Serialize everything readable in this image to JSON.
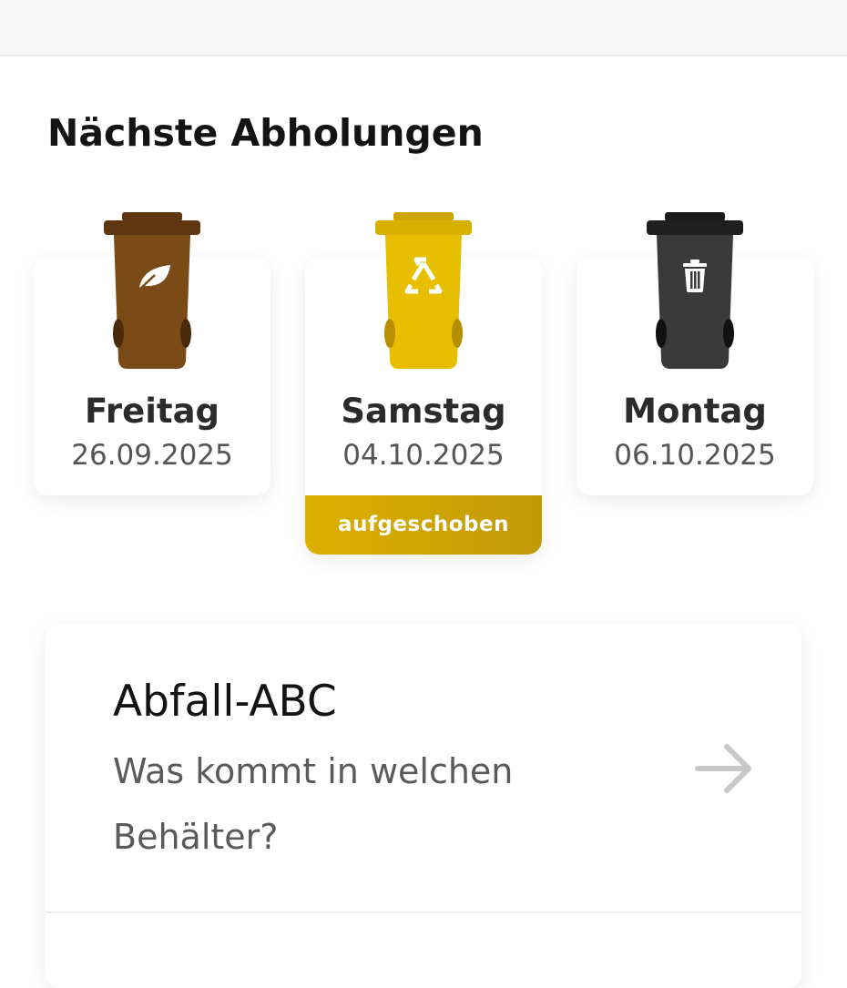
{
  "section_title": "Nächste Abholungen",
  "pickups": [
    {
      "weekday": "Freitag",
      "date": "26.09.2025",
      "bin_type": "Bio",
      "bin_color": "#7a4a17",
      "icon": "leaf-icon",
      "status": ""
    },
    {
      "weekday": "Samstag",
      "date": "04.10.2025",
      "bin_type": "Gelber Sack",
      "bin_color": "#e7bf00",
      "icon": "recycle-icon",
      "status": "aufgeschoben"
    },
    {
      "weekday": "Montag",
      "date": "06.10.2025",
      "bin_type": "Restmüll",
      "bin_color": "#3a3a3a",
      "icon": "trash-icon",
      "status": ""
    }
  ],
  "abc_card": {
    "title": "Abfall-ABC",
    "subtitle": "Was kommt in welchen Behälter?",
    "icon": "arrow-right-icon"
  },
  "colors": {
    "accent": "#d4aa00",
    "text_dark": "#141414",
    "text_muted": "#5a5a5a"
  }
}
